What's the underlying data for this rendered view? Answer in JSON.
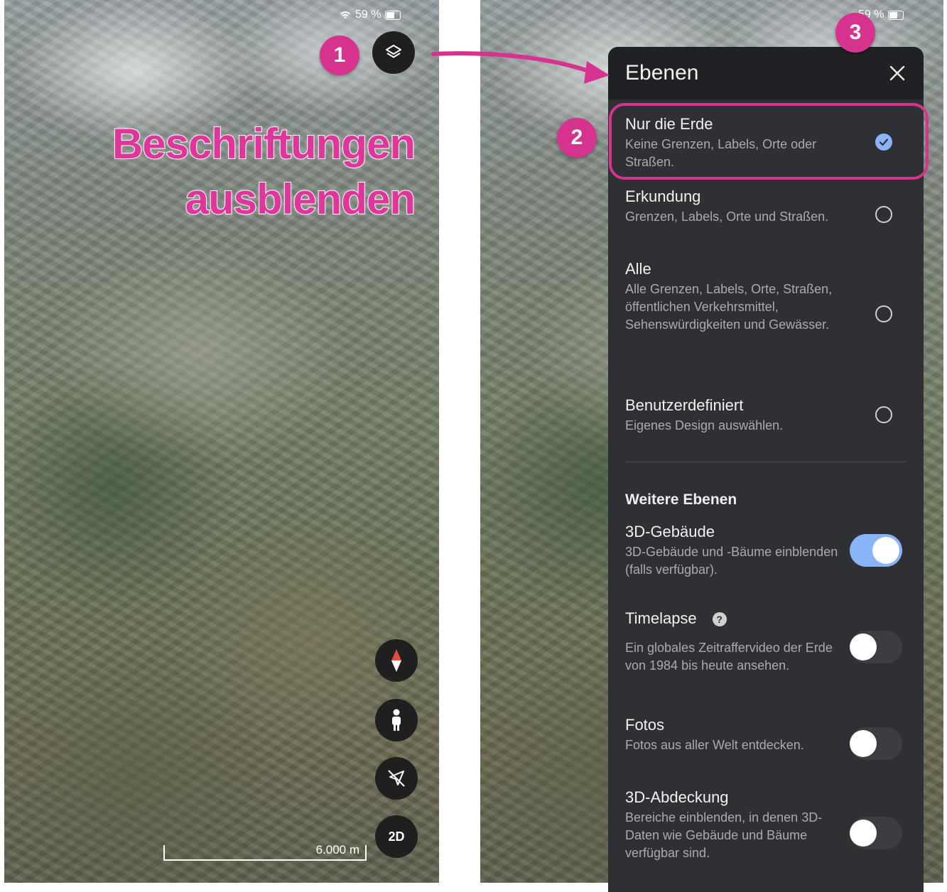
{
  "left_screen": {
    "status": {
      "battery_percent": "59 %"
    },
    "headline": {
      "line1": "Beschriftungen",
      "line2": "ausblenden"
    },
    "controls": {
      "view_mode_label": "2D"
    },
    "scale": {
      "label": "6.000 m"
    }
  },
  "right_screen": {
    "status": {
      "battery_percent": "59 %"
    }
  },
  "callouts": {
    "one": "1",
    "two": "2",
    "three": "3"
  },
  "accent_color": "#d6338f",
  "panel": {
    "title": "Ebenen",
    "map_styles": [
      {
        "title": "Nur die Erde",
        "description": "Keine Grenzen, Labels, Orte oder Straßen.",
        "selected": true
      },
      {
        "title": "Erkundung",
        "description": "Grenzen, Labels, Orte und Straßen.",
        "selected": false
      },
      {
        "title": "Alle",
        "description": "Alle Grenzen, Labels, Orte, Straßen, öffentlichen Verkehrsmittel, Sehenswürdigkeiten und Gewässer.",
        "selected": false
      },
      {
        "title": "Benutzerdefiniert",
        "description": "Eigenes Design auswählen.",
        "selected": false
      }
    ],
    "more_layers_title": "Weitere Ebenen",
    "layers": [
      {
        "title": "3D-Gebäude",
        "description": "3D-Gebäude und -Bäume einblenden (falls verfügbar).",
        "enabled": true
      },
      {
        "title": "Timelapse",
        "description": "Ein globales Zeitraffervideo der Erde von 1984 bis heute ansehen.",
        "enabled": false
      },
      {
        "title": "Fotos",
        "description": "Fotos aus aller Welt entdecken.",
        "enabled": false
      },
      {
        "title": "3D-Abdeckung",
        "description": "Bereiche einblenden, in denen 3D-Daten wie Gebäude und Bäume verfügbar sind.",
        "enabled": false
      }
    ]
  }
}
